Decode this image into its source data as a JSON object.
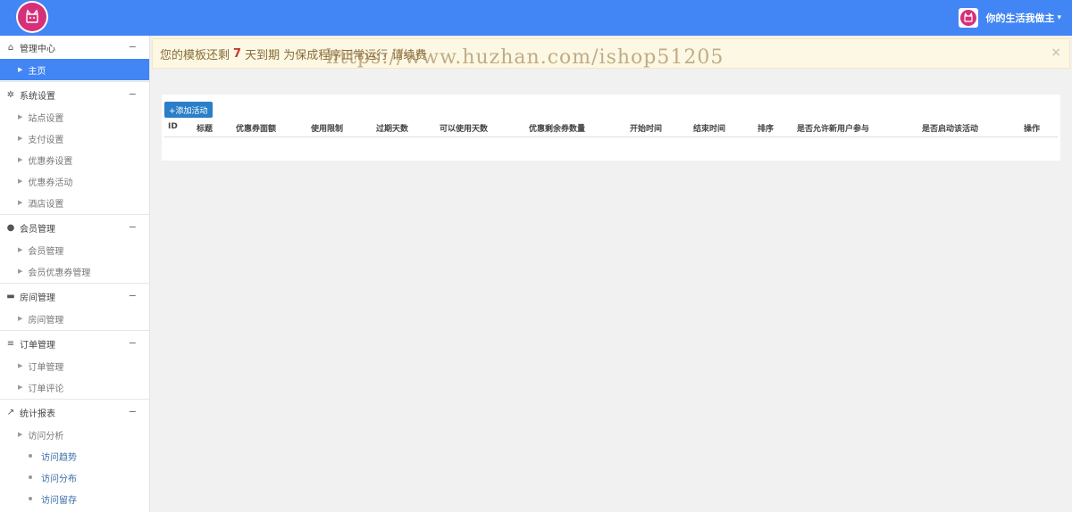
{
  "header": {
    "logo_icon": "cat-logo-icon",
    "user_name": "你的生活我做主",
    "caret": "▾"
  },
  "sidebar": {
    "groups": [
      {
        "icon": "home-icon",
        "glyph": "⌂",
        "label": "管理中心",
        "collapse": "−",
        "items": [
          {
            "label": "主页",
            "active": true
          }
        ]
      },
      {
        "icon": "gear-icon",
        "glyph": "✲",
        "label": "系统设置",
        "collapse": "−",
        "items": [
          {
            "label": "站点设置"
          },
          {
            "label": "支付设置"
          },
          {
            "label": "优惠券设置"
          },
          {
            "label": "优惠券活动"
          },
          {
            "label": "酒店设置"
          }
        ]
      },
      {
        "icon": "user-icon",
        "glyph": "●",
        "label": "会员管理",
        "collapse": "−",
        "items": [
          {
            "label": "会员管理"
          },
          {
            "label": "会员优惠券管理"
          }
        ]
      },
      {
        "icon": "bed-icon",
        "glyph": "▬",
        "label": "房间管理",
        "collapse": "−",
        "items": [
          {
            "label": "房间管理"
          }
        ]
      },
      {
        "icon": "list-icon",
        "glyph": "≡",
        "label": "订单管理",
        "collapse": "−",
        "items": [
          {
            "label": "订单管理"
          },
          {
            "label": "订单评论"
          }
        ]
      },
      {
        "icon": "line-chart-icon",
        "glyph": "↗",
        "label": "统计报表",
        "collapse": "−",
        "items": [
          {
            "label": "访问分析"
          }
        ],
        "subitems": [
          {
            "label": "访问趋势"
          },
          {
            "label": "访问分布"
          },
          {
            "label": "访问留存"
          }
        ]
      }
    ]
  },
  "alert": {
    "text_before": "您的模板还剩",
    "days": "7",
    "text_after": "天到期 为保成程序正常运行 请续费",
    "close": "×",
    "watermark": "https://www.huzhan.com/ishop51205"
  },
  "table": {
    "add_button": "+添加活动",
    "columns": [
      "ID",
      "标题",
      "优惠券面额",
      "使用限制",
      "过期天数",
      "可以使用天数",
      "优惠剩余券数量",
      "开始时间",
      "结束时间",
      "排序",
      "是否允许新用户参与",
      "是否启动该活动",
      "操作"
    ]
  }
}
